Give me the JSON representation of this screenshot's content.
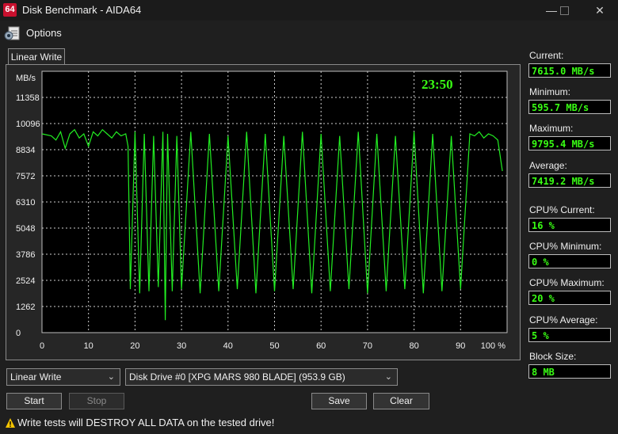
{
  "window": {
    "icon_text": "64",
    "title": "Disk Benchmark - AIDA64"
  },
  "menu": {
    "options": "Options"
  },
  "tab": {
    "label": "Linear Write"
  },
  "chart": {
    "timer": "23:50"
  },
  "chart_data": {
    "type": "line",
    "xlabel": "",
    "ylabel": "MB/s",
    "x_ticks": [
      "0",
      "10",
      "20",
      "30",
      "40",
      "50",
      "60",
      "70",
      "80",
      "90",
      "100 %"
    ],
    "y_ticks": [
      "11358",
      "10096",
      "8834",
      "7572",
      "6310",
      "5048",
      "3786",
      "2524",
      "1262",
      "0"
    ],
    "xlim": [
      0,
      100
    ],
    "ylim": [
      0,
      12620
    ],
    "grid": true,
    "series_color": "#22ee22",
    "series": [
      {
        "x": [
          0,
          2,
          3,
          4,
          5,
          6,
          7,
          8,
          9,
          10,
          11,
          12,
          13,
          14,
          15,
          16,
          17,
          18,
          18.5,
          19,
          20,
          21,
          22,
          23,
          24,
          25,
          26,
          26.5,
          27,
          28,
          29,
          30,
          32,
          34,
          36,
          38,
          40,
          42,
          44,
          46,
          48,
          50,
          52,
          54,
          56,
          58,
          60,
          62,
          64,
          66,
          68,
          70,
          72,
          74,
          76,
          78,
          80,
          82,
          84,
          86,
          88,
          90,
          92,
          93,
          94,
          95,
          96,
          97,
          98,
          99
        ],
        "y": [
          9600,
          9500,
          9300,
          9700,
          8900,
          9600,
          9800,
          9400,
          9600,
          9000,
          9700,
          9500,
          9800,
          9600,
          9400,
          9700,
          9500,
          9600,
          9000,
          2100,
          9700,
          1900,
          9600,
          2000,
          9500,
          2200,
          9700,
          600,
          9600,
          2000,
          9500,
          2100,
          9700,
          1900,
          9600,
          2000,
          9500,
          2100,
          9700,
          1900,
          9600,
          2000,
          9500,
          2100,
          9700,
          1900,
          9600,
          2000,
          9500,
          2100,
          9700,
          1900,
          9600,
          2000,
          9500,
          2100,
          9700,
          1900,
          9600,
          2000,
          9500,
          2100,
          9600,
          9500,
          9700,
          9400,
          9600,
          9500,
          9300,
          7800
        ]
      }
    ]
  },
  "stats": [
    {
      "label": "Current:",
      "value": "7615.0 MB/s"
    },
    {
      "label": "Minimum:",
      "value": "595.7 MB/s"
    },
    {
      "label": "Maximum:",
      "value": "9795.4 MB/s"
    },
    {
      "label": "Average:",
      "value": "7419.2 MB/s"
    },
    {
      "label": "CPU% Current:",
      "value": "16 %"
    },
    {
      "label": "CPU% Minimum:",
      "value": "0 %"
    },
    {
      "label": "CPU% Maximum:",
      "value": "20 %"
    },
    {
      "label": "CPU% Average:",
      "value": "5 %"
    },
    {
      "label": "Block Size:",
      "value": "8 MB"
    }
  ],
  "controls": {
    "test_select": "Linear Write",
    "drive_select": "Disk Drive #0  [XPG MARS 980 BLADE]  (953.9 GB)",
    "start": "Start",
    "stop": "Stop",
    "save": "Save",
    "clear": "Clear"
  },
  "warning": "Write tests will DESTROY ALL DATA on the tested drive!",
  "colors": {
    "accent_red": "#c8102e",
    "graph_green": "#22ee22",
    "value_green": "#39ff14",
    "warning_yellow": "#f5c400"
  }
}
